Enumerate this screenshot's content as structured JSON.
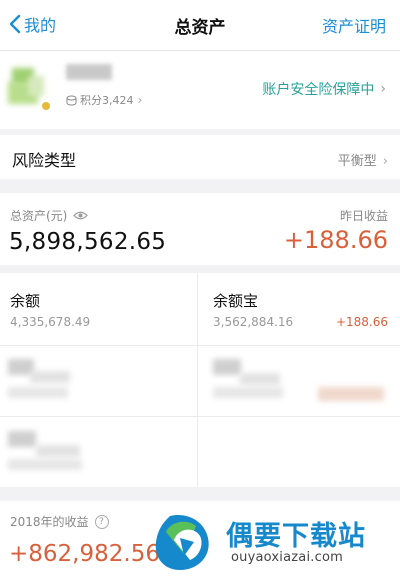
{
  "header": {
    "back_label": "我的",
    "title": "总资产",
    "certificate_label": "资产证明"
  },
  "account": {
    "points_label": "积分3,424",
    "security_label": "账户安全险保障中"
  },
  "risk": {
    "label": "风险类型",
    "value": "平衡型"
  },
  "assets": {
    "total_label": "总资产(元)",
    "total_value": "5,898,562.65",
    "yesterday_label": "昨日收益",
    "yesterday_value": "+188.66"
  },
  "products": [
    {
      "name": "余额",
      "amount": "4,335,678.49",
      "income": ""
    },
    {
      "name": "余额宝",
      "amount": "3,562,884.16",
      "income": "+188.66"
    }
  ],
  "annual": {
    "label": "2018年的收益",
    "value": "+862,982.56"
  },
  "watermark": {
    "title": "偶要下载站",
    "url": "ouyaoxiazai.com"
  },
  "colors": {
    "accent_blue": "#1a8fd6",
    "teal": "#27a29a",
    "income_orange": "#d8603a"
  }
}
